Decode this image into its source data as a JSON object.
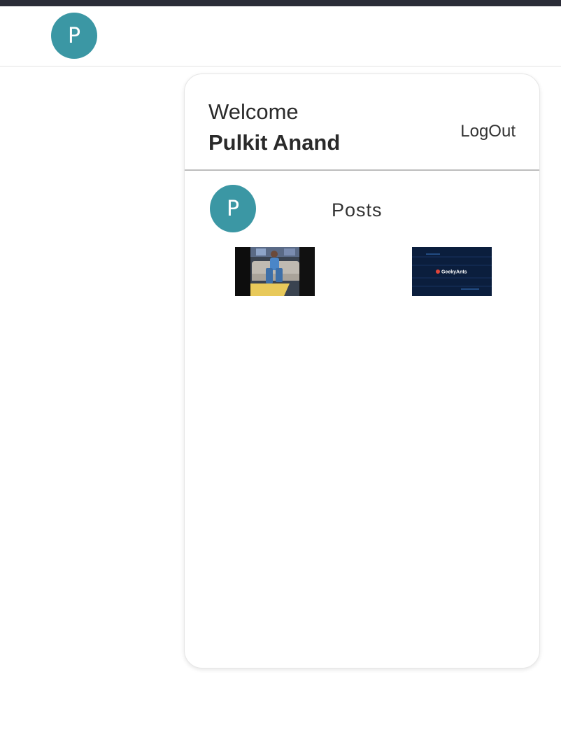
{
  "app_bar": {
    "avatar_initial": "P"
  },
  "card": {
    "welcome_label": "Welcome",
    "user_name": "Pulkit Anand",
    "logout_label": "LogOut",
    "posts": {
      "avatar_initial": "P",
      "title": "Posts",
      "items": [
        {
          "type": "image",
          "caption": ""
        },
        {
          "type": "image",
          "caption": "GeekyAnts"
        }
      ]
    }
  },
  "colors": {
    "avatar_bg": "#3b97a4",
    "top_strip": "#2b2d38",
    "thumb_2_bg": "#0b1e3d"
  }
}
